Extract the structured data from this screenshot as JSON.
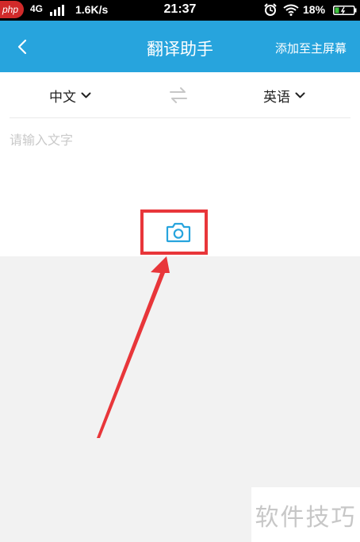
{
  "status_bar": {
    "badge": "php",
    "network": "4G",
    "speed": "1.6K/s",
    "time": "21:37",
    "battery_pct": "18%"
  },
  "header": {
    "title": "翻译助手",
    "add_home_label": "添加至主屏幕"
  },
  "languages": {
    "source": "中文",
    "target": "英语"
  },
  "input": {
    "placeholder": "请输入文字",
    "value": ""
  },
  "watermark": "软件技巧",
  "colors": {
    "accent": "#27a4dd",
    "annotation": "#e8363a"
  },
  "icons": {
    "back": "chevron-left-icon",
    "swap": "swap-arrows-icon",
    "camera": "camera-icon"
  }
}
